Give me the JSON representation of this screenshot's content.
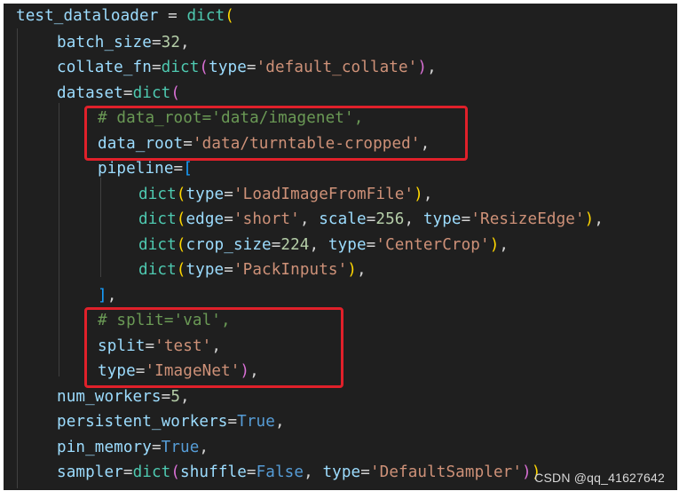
{
  "editor": {
    "lines": [
      [
        [
          "test_dataloader",
          "var"
        ],
        [
          " = ",
          "op"
        ],
        [
          "dict",
          "fn"
        ],
        [
          "(",
          "b1"
        ]
      ],
      [
        [
          "batch_size",
          "var"
        ],
        [
          "=",
          "op"
        ],
        [
          "32",
          "num"
        ],
        [
          ",",
          "op"
        ]
      ],
      [
        [
          "collate_fn",
          "var"
        ],
        [
          "=",
          "op"
        ],
        [
          "dict",
          "fn"
        ],
        [
          "(",
          "b2"
        ],
        [
          "type",
          "var"
        ],
        [
          "=",
          "op"
        ],
        [
          "'default_collate'",
          "str"
        ],
        [
          ")",
          "b2"
        ],
        [
          ",",
          "op"
        ]
      ],
      [
        [
          "dataset",
          "var"
        ],
        [
          "=",
          "op"
        ],
        [
          "dict",
          "fn"
        ],
        [
          "(",
          "b2"
        ]
      ],
      [
        [
          "# data_root='data/imagenet',",
          "com"
        ]
      ],
      [
        [
          "data_root",
          "var"
        ],
        [
          "=",
          "op"
        ],
        [
          "'data/turntable-cropped'",
          "str"
        ],
        [
          ",",
          "op"
        ]
      ],
      [
        [
          "pipeline",
          "var"
        ],
        [
          "=",
          "op"
        ],
        [
          "[",
          "b3"
        ]
      ],
      [
        [
          "dict",
          "fn"
        ],
        [
          "(",
          "b1"
        ],
        [
          "type",
          "var"
        ],
        [
          "=",
          "op"
        ],
        [
          "'LoadImageFromFile'",
          "str"
        ],
        [
          ")",
          "b1"
        ],
        [
          ",",
          "op"
        ]
      ],
      [
        [
          "dict",
          "fn"
        ],
        [
          "(",
          "b1"
        ],
        [
          "edge",
          "var"
        ],
        [
          "=",
          "op"
        ],
        [
          "'short'",
          "str"
        ],
        [
          ", ",
          "op"
        ],
        [
          "scale",
          "var"
        ],
        [
          "=",
          "op"
        ],
        [
          "256",
          "num"
        ],
        [
          ", ",
          "op"
        ],
        [
          "type",
          "var"
        ],
        [
          "=",
          "op"
        ],
        [
          "'ResizeEdge'",
          "str"
        ],
        [
          ")",
          "b1"
        ],
        [
          ",",
          "op"
        ]
      ],
      [
        [
          "dict",
          "fn"
        ],
        [
          "(",
          "b1"
        ],
        [
          "crop_size",
          "var"
        ],
        [
          "=",
          "op"
        ],
        [
          "224",
          "num"
        ],
        [
          ", ",
          "op"
        ],
        [
          "type",
          "var"
        ],
        [
          "=",
          "op"
        ],
        [
          "'CenterCrop'",
          "str"
        ],
        [
          ")",
          "b1"
        ],
        [
          ",",
          "op"
        ]
      ],
      [
        [
          "dict",
          "fn"
        ],
        [
          "(",
          "b1"
        ],
        [
          "type",
          "var"
        ],
        [
          "=",
          "op"
        ],
        [
          "'PackInputs'",
          "str"
        ],
        [
          ")",
          "b1"
        ],
        [
          ",",
          "op"
        ]
      ],
      [
        [
          "]",
          "b3"
        ],
        [
          ",",
          "op"
        ]
      ],
      [
        [
          "# split='val',",
          "com"
        ]
      ],
      [
        [
          "split",
          "var"
        ],
        [
          "=",
          "op"
        ],
        [
          "'test'",
          "str"
        ],
        [
          ",",
          "op"
        ]
      ],
      [
        [
          "type",
          "var"
        ],
        [
          "=",
          "op"
        ],
        [
          "'ImageNet'",
          "str"
        ],
        [
          ")",
          "b2"
        ],
        [
          ",",
          "op"
        ]
      ],
      [
        [
          "num_workers",
          "var"
        ],
        [
          "=",
          "op"
        ],
        [
          "5",
          "num"
        ],
        [
          ",",
          "op"
        ]
      ],
      [
        [
          "persistent_workers",
          "var"
        ],
        [
          "=",
          "op"
        ],
        [
          "True",
          "kw"
        ],
        [
          ",",
          "op"
        ]
      ],
      [
        [
          "pin_memory",
          "var"
        ],
        [
          "=",
          "op"
        ],
        [
          "True",
          "kw"
        ],
        [
          ",",
          "op"
        ]
      ],
      [
        [
          "sampler",
          "var"
        ],
        [
          "=",
          "op"
        ],
        [
          "dict",
          "fn"
        ],
        [
          "(",
          "b2"
        ],
        [
          "shuffle",
          "var"
        ],
        [
          "=",
          "op"
        ],
        [
          "False",
          "kw"
        ],
        [
          ", ",
          "op"
        ],
        [
          "type",
          "var"
        ],
        [
          "=",
          "op"
        ],
        [
          "'DefaultSampler'",
          "str"
        ],
        [
          ")",
          "b2"
        ],
        [
          ")",
          "b1"
        ]
      ]
    ]
  },
  "watermark": "CSDN @qq_41627642",
  "colors": {
    "background": "#1f1f1f",
    "highlight_box": "#e0202a"
  }
}
